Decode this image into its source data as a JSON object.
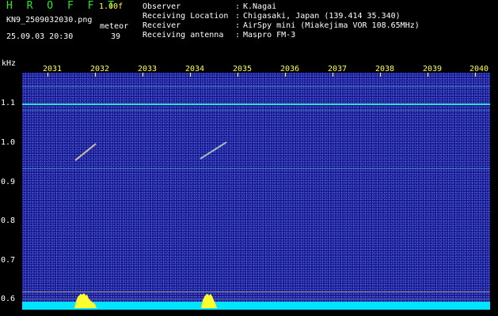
{
  "header": {
    "app_title": "H R O F F T",
    "version": "1.00f",
    "filename": "KN9_2509032030.png",
    "meteor_label": "meteor",
    "datetime": "25.09.03 20:30",
    "meteor_count": "39"
  },
  "info": {
    "separator": ":",
    "rows": [
      {
        "label": "Observer",
        "value": "K.Nagai"
      },
      {
        "label": "Receiving Location",
        "value": "Chigasaki, Japan (139.414 35.340)"
      },
      {
        "label": "Receiver",
        "value": "AirSpy mini (Miakejima VOR 108.65MHz)"
      },
      {
        "label": "Receiving antenna",
        "value": "Maspro FM-3"
      }
    ]
  },
  "axes": {
    "y_unit": "kHz",
    "y_ticks": [
      "1.1",
      "1.0",
      "0.9",
      "0.8",
      "0.7",
      "0.6"
    ],
    "x_ticks": [
      "2031",
      "2032",
      "2033",
      "2034",
      "2035",
      "2036",
      "2037",
      "2038",
      "2039",
      "2040"
    ]
  },
  "colors": {
    "background": "#000000",
    "plot_noise": "#15168c",
    "title_green": "#2ee82e",
    "tick_yellow": "#ffff40",
    "carrier_line": "#30e0d0",
    "spectrum_cyan": "#00e5ff",
    "spectrum_yellow": "#ffff30"
  }
}
